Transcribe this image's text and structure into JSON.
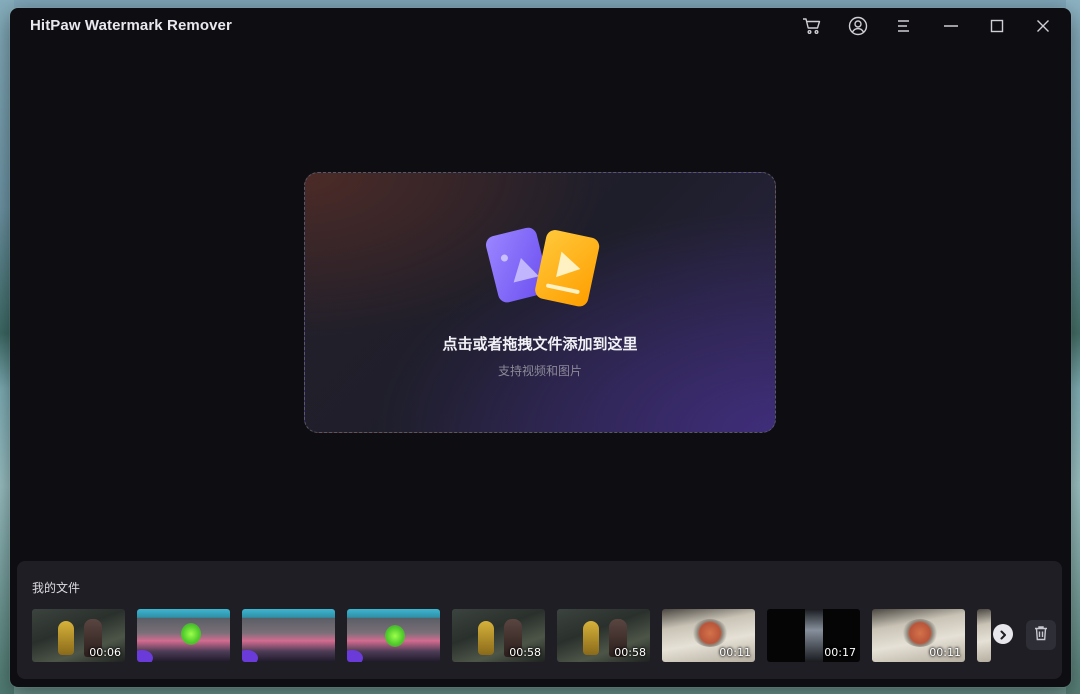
{
  "app": {
    "title": "HitPaw Watermark Remover"
  },
  "titlebar": {
    "icons": [
      "cart-icon",
      "account-icon",
      "menu-icon",
      "minimize-icon",
      "maximize-icon",
      "close-icon"
    ]
  },
  "dropzone": {
    "title": "点击或者拖拽文件添加到这里",
    "subtitle": "支持视频和图片",
    "icon": "media-files-icon"
  },
  "files": {
    "title": "我的文件",
    "thumbnails": [
      {
        "duration": "00:06",
        "scene": "dark"
      },
      {
        "duration": "",
        "scene": "game"
      },
      {
        "duration": "",
        "scene": "game"
      },
      {
        "duration": "",
        "scene": "game"
      },
      {
        "duration": "00:58",
        "scene": "dark"
      },
      {
        "duration": "00:58",
        "scene": "dark"
      },
      {
        "duration": "00:11",
        "scene": "paper"
      },
      {
        "duration": "00:17",
        "scene": "black"
      },
      {
        "duration": "00:11",
        "scene": "paper"
      }
    ],
    "next_icon": "chevron-right-icon",
    "delete_icon": "trash-icon"
  },
  "colors": {
    "window_bg": "#0e0d12",
    "panel_bg": "#1e1e24",
    "accent_purple": "#7b61ff",
    "accent_yellow": "#ffb300"
  }
}
